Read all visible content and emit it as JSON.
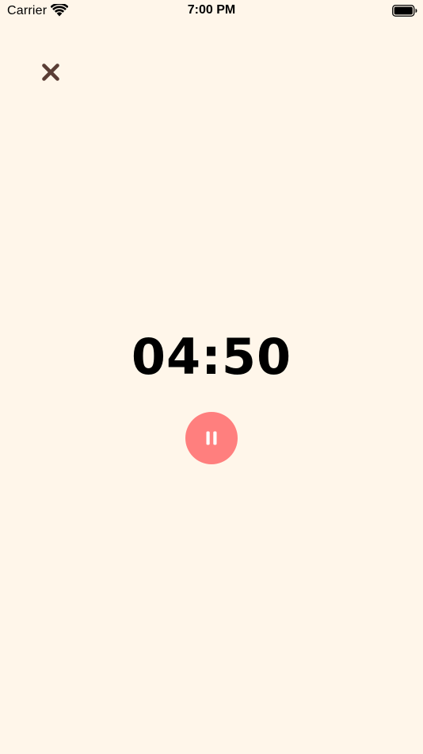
{
  "status_bar": {
    "carrier": "Carrier",
    "time": "7:00 PM",
    "wifi_icon": "wifi-icon",
    "battery_icon": "battery-full-icon"
  },
  "close": {
    "icon": "close-icon",
    "color": "#5A3D35"
  },
  "timer": {
    "remaining": "04:50"
  },
  "controls": {
    "pause_icon": "pause-icon",
    "pause_color": "#FF7F7E",
    "icon_color": "#FFFFFF"
  },
  "theme": {
    "background": "#FFF6EA",
    "text": "#000000"
  }
}
